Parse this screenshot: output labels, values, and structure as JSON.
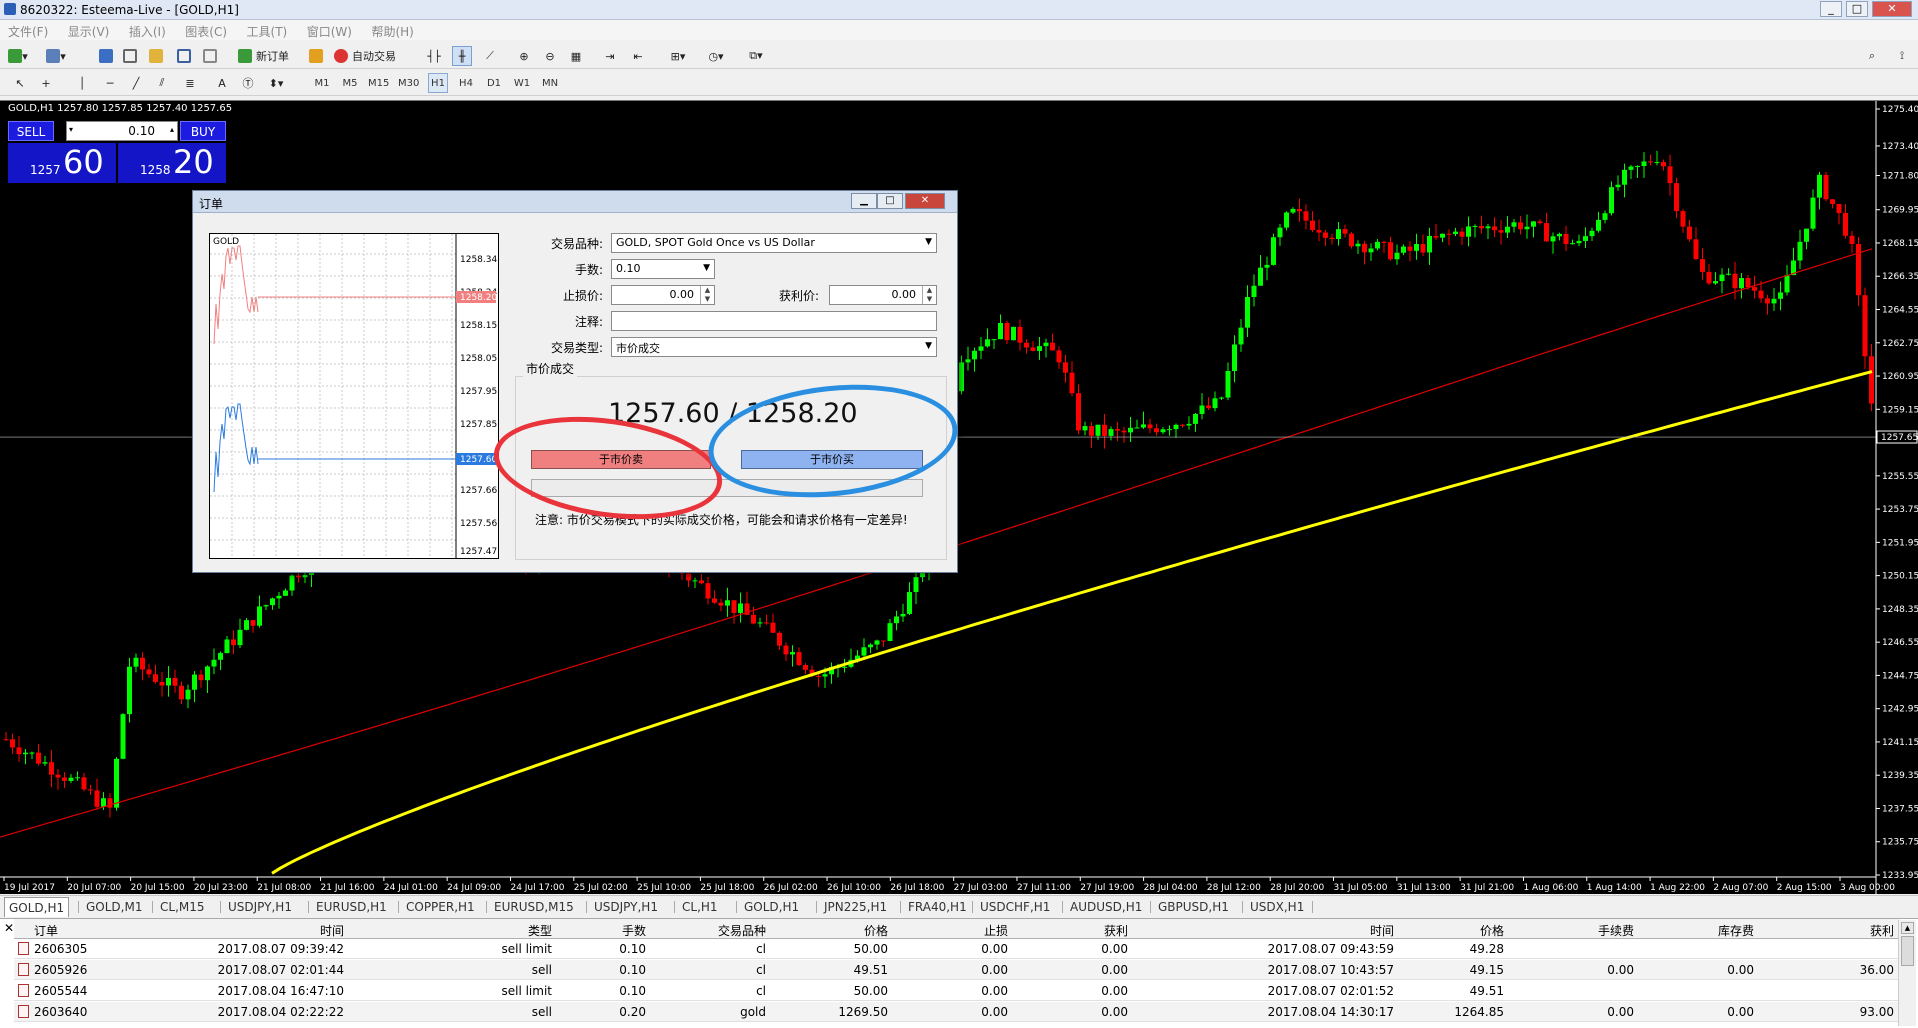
{
  "window": {
    "title": "8620322: Esteema-Live - [GOLD,H1]",
    "controls": [
      "_",
      "□",
      "✕"
    ]
  },
  "menu": [
    "文件(F)",
    "显示(V)",
    "插入(I)",
    "图表(C)",
    "工具(T)",
    "窗口(W)",
    "帮助(H)"
  ],
  "toolbar": {
    "new_order": "新订单",
    "auto_trading": "自动交易",
    "timeframes": [
      "M1",
      "M5",
      "M15",
      "M30",
      "H1",
      "H4",
      "D1",
      "W1",
      "MN"
    ],
    "active_timeframe": "H1"
  },
  "chart": {
    "symbol_line": "GOLD,H1  1257.80 1257.85 1257.40 1257.65",
    "current_price_label": "1257.65",
    "price_ticks": [
      "1275.40",
      "1273.40",
      "1271.80",
      "1269.95",
      "1268.15",
      "1266.35",
      "1264.55",
      "1262.75",
      "1260.95",
      "1259.15",
      "1257.65",
      "1255.55",
      "1253.75",
      "1251.95",
      "1250.15",
      "1248.35",
      "1246.55",
      "1244.75",
      "1242.95",
      "1241.15",
      "1239.35",
      "1237.55",
      "1235.75",
      "1233.95"
    ],
    "time_ticks": [
      "19 Jul 2017",
      "20 Jul 07:00",
      "20 Jul 15:00",
      "20 Jul 23:00",
      "21 Jul 08:00",
      "21 Jul 16:00",
      "24 Jul 01:00",
      "24 Jul 09:00",
      "24 Jul 17:00",
      "25 Jul 02:00",
      "25 Jul 10:00",
      "25 Jul 18:00",
      "26 Jul 02:00",
      "26 Jul 10:00",
      "26 Jul 18:00",
      "27 Jul 03:00",
      "27 Jul 11:00",
      "27 Jul 19:00",
      "28 Jul 04:00",
      "28 Jul 12:00",
      "28 Jul 20:00",
      "31 Jul 05:00",
      "31 Jul 13:00",
      "31 Jul 21:00",
      "1 Aug 06:00",
      "1 Aug 14:00",
      "1 Aug 22:00",
      "2 Aug 07:00",
      "2 Aug 15:00",
      "3 Aug 00:00"
    ],
    "colors": {
      "bull": "#00ff00",
      "bear": "#ff0000",
      "ma_fast": "#e00000",
      "ma_slow": "#ffff00",
      "background": "#000000"
    }
  },
  "one_click": {
    "sell_label": "SELL",
    "buy_label": "BUY",
    "lot": "0.10",
    "sell_small": "1257",
    "sell_big": "60",
    "buy_small": "1258",
    "buy_big": "20"
  },
  "dialog": {
    "title": "订单",
    "mini_chart": {
      "symbol": "GOLD",
      "ticks": [
        "1258.34",
        "1258.24",
        "1258.15",
        "1258.05",
        "1257.95",
        "1257.85",
        "1257.76",
        "1257.66",
        "1257.56",
        "1257.47"
      ],
      "ask_tag": "1258.20",
      "bid_tag": "1257.60"
    },
    "symbol_label": "交易品种:",
    "symbol_value": "GOLD, SPOT Gold Once vs US Dollar",
    "volume_label": "手数:",
    "volume_value": "0.10",
    "sl_label": "止损价:",
    "sl_value": "0.00",
    "tp_label": "获利价:",
    "tp_value": "0.00",
    "comment_label": "注释:",
    "comment_value": "",
    "type_label": "交易类型:",
    "type_value": "市价成交",
    "group_title": "市价成交",
    "price_display": "1257.60 / 1258.20",
    "sell_button": "于市价卖",
    "buy_button": "于市价买",
    "note": "注意: 市价交易模式下的实际成交价格，可能会和请求价格有一定差异!"
  },
  "chart_tabs": [
    "GOLD,H1",
    "GOLD,M1",
    "CL,M15",
    "USDJPY,H1",
    "EURUSD,H1",
    "COPPER,H1",
    "EURUSD,M15",
    "USDJPY,H1",
    "CL,H1",
    "GOLD,H1",
    "JPN225,H1",
    "FRA40,H1",
    "USDCHF,H1",
    "AUDUSD,H1",
    "GBPUSD,H1",
    "USDX,H1"
  ],
  "terminal": {
    "headers": [
      "订单",
      "时间",
      "类型",
      "手数",
      "交易品种",
      "价格",
      "止损",
      "获利",
      "时间",
      "价格",
      "手续费",
      "库存费",
      "获利"
    ],
    "rows": [
      [
        "2606305",
        "2017.08.07 09:39:42",
        "sell limit",
        "0.10",
        "cl",
        "50.00",
        "0.00",
        "0.00",
        "2017.08.07 09:43:59",
        "49.28",
        "",
        "",
        ""
      ],
      [
        "2605926",
        "2017.08.07 02:01:44",
        "sell",
        "0.10",
        "cl",
        "49.51",
        "0.00",
        "0.00",
        "2017.08.07 10:43:57",
        "49.15",
        "0.00",
        "0.00",
        "36.00"
      ],
      [
        "2605544",
        "2017.08.04 16:47:10",
        "sell limit",
        "0.10",
        "cl",
        "50.00",
        "0.00",
        "0.00",
        "2017.08.07 02:01:52",
        "49.51",
        "",
        "",
        ""
      ],
      [
        "2603640",
        "2017.08.04 02:22:22",
        "sell",
        "0.20",
        "gold",
        "1269.50",
        "0.00",
        "0.00",
        "2017.08.04 14:30:17",
        "1264.85",
        "0.00",
        "0.00",
        "93.00"
      ]
    ]
  }
}
